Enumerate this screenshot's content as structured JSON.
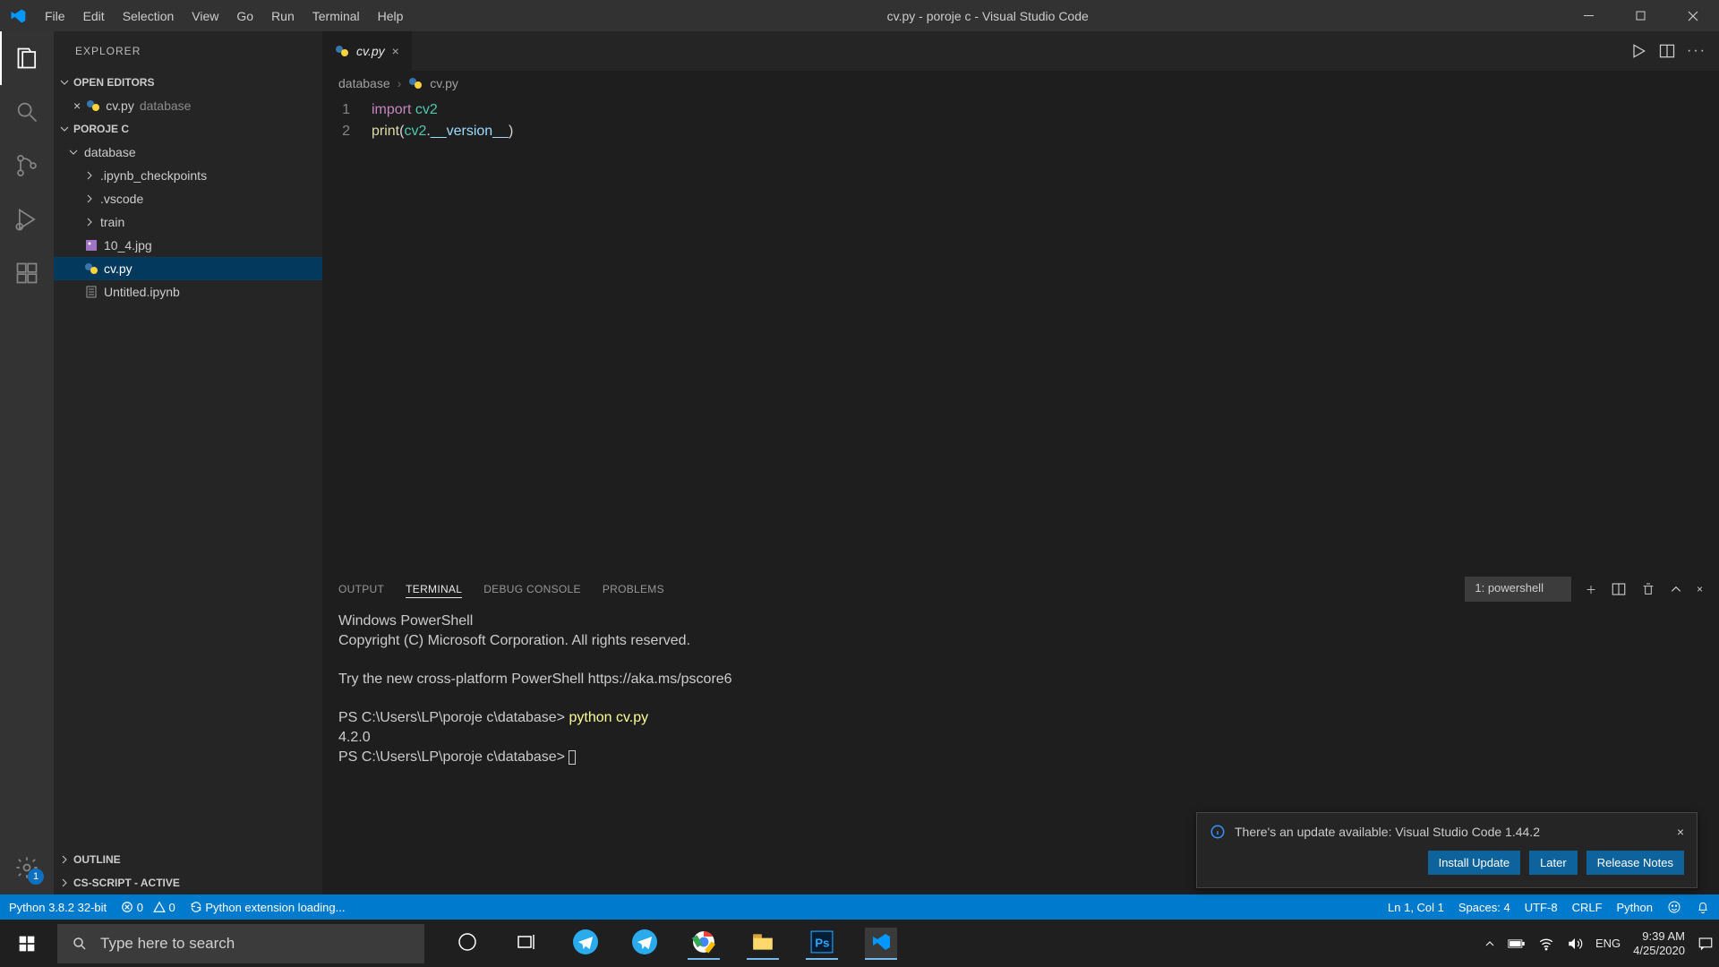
{
  "titlebar": {
    "title": "cv.py - poroje c - Visual Studio Code",
    "menus": [
      "File",
      "Edit",
      "Selection",
      "View",
      "Go",
      "Run",
      "Terminal",
      "Help"
    ]
  },
  "sidebar": {
    "title": "EXPLORER",
    "open_editors_label": "OPEN EDITORS",
    "open_editor_file": "cv.py",
    "open_editor_dir": "database",
    "project_label": "POROJE C",
    "tree": {
      "folder": "database",
      "items": [
        {
          "name": ".ipynb_checkpoints",
          "type": "folder"
        },
        {
          "name": ".vscode",
          "type": "folder"
        },
        {
          "name": "train",
          "type": "folder"
        },
        {
          "name": "10_4.jpg",
          "type": "img"
        },
        {
          "name": "cv.py",
          "type": "py",
          "selected": true
        },
        {
          "name": "Untitled.ipynb",
          "type": "ipynb"
        }
      ]
    },
    "outline_label": "OUTLINE",
    "csscript_label": "CS-SCRIPT - ACTIVE"
  },
  "editor": {
    "tab_name": "cv.py",
    "breadcrumb_folder": "database",
    "breadcrumb_file": "cv.py",
    "lines": {
      "l1": {
        "kw": "import",
        "sp": " ",
        "id": "cv2"
      },
      "l2": {
        "fn": "print",
        "open": "(",
        "obj": "cv2",
        "dot": ".",
        "attr": "__version__",
        "close": ")"
      }
    }
  },
  "panel": {
    "tabs": [
      "OUTPUT",
      "TERMINAL",
      "DEBUG CONSOLE",
      "PROBLEMS"
    ],
    "active": 1,
    "select": "1: powershell",
    "lines": {
      "l1": "Windows PowerShell",
      "l2": "Copyright (C) Microsoft Corporation. All rights reserved.",
      "l3": "",
      "l4": "Try the new cross-platform PowerShell https://aka.ms/pscore6",
      "l5": "",
      "p1": "PS C:\\Users\\LP\\poroje c\\database> ",
      "cmd": "python cv.py",
      "out": "4.2.0",
      "p2": "PS C:\\Users\\LP\\poroje c\\database> "
    }
  },
  "notification": {
    "text": "There's an update available: Visual Studio Code 1.44.2",
    "btn_install": "Install Update",
    "btn_later": "Later",
    "btn_notes": "Release Notes"
  },
  "statusbar": {
    "python": "Python 3.8.2 32-bit",
    "errors": "0",
    "warnings": "0",
    "loading": "Python extension loading...",
    "lncol": "Ln 1, Col 1",
    "spaces": "Spaces: 4",
    "enc": "UTF-8",
    "eol": "CRLF",
    "lang": "Python"
  },
  "taskbar": {
    "search_placeholder": "Type here to search",
    "lang": "ENG",
    "time": "9:39 AM",
    "date": "4/25/2020"
  },
  "activity_badge": "1"
}
